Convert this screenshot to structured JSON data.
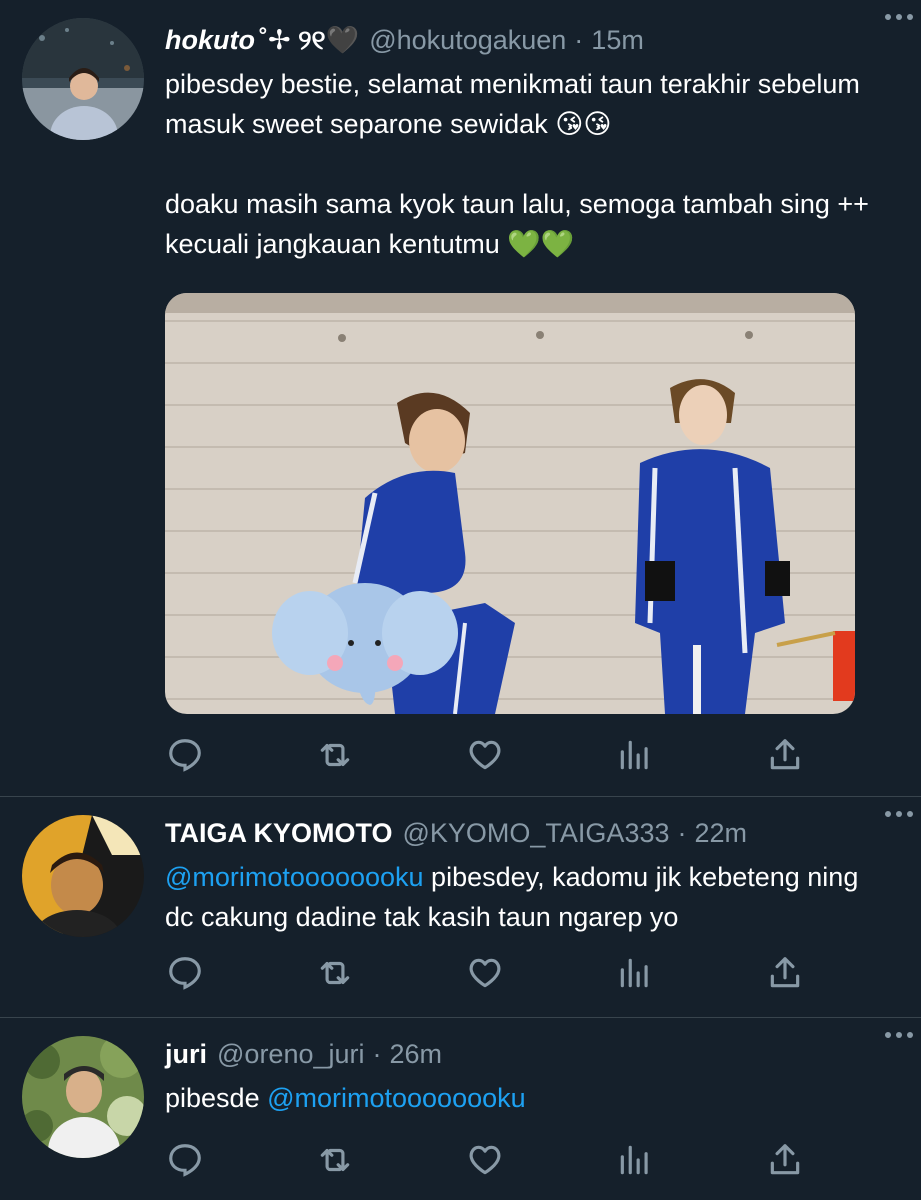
{
  "tweets": [
    {
      "name": "hokuto",
      "name_suffix": "˚✢ ୨୧🖤",
      "handle": "@hokutogakuen",
      "time": "15m",
      "paragraph1": "pibesdey bestie, selamat menikmati taun terakhir sebelum masuk sweet separone sewidak 😘😘",
      "paragraph2_text": "doaku masih sama kyok taun lalu, semoga tambah sing ++ kecuali jangkauan kentutmu",
      "paragraph2_emoji": "💚💚"
    },
    {
      "name": "TAIGA KYOMOTO",
      "handle": "@KYOMO_TAIGA333",
      "time": "22m",
      "mention": "@morimotoooooooku",
      "text": " pibesdey, kadomu jik kebeteng ning dc cakung dadine tak kasih taun ngarep yo"
    },
    {
      "name": "juri",
      "handle": "@oreno_juri",
      "time": "26m",
      "text": "pibesde ",
      "mention": "@morimotoooooooku"
    }
  ],
  "separator": "·",
  "icons": [
    "reply-icon",
    "retweet-icon",
    "like-icon",
    "analytics-icon",
    "share-icon",
    "more-icon"
  ],
  "colors": {
    "background": "#15202b",
    "muted": "#8899a6",
    "accent": "#1da1f2",
    "divider": "#38444d"
  }
}
